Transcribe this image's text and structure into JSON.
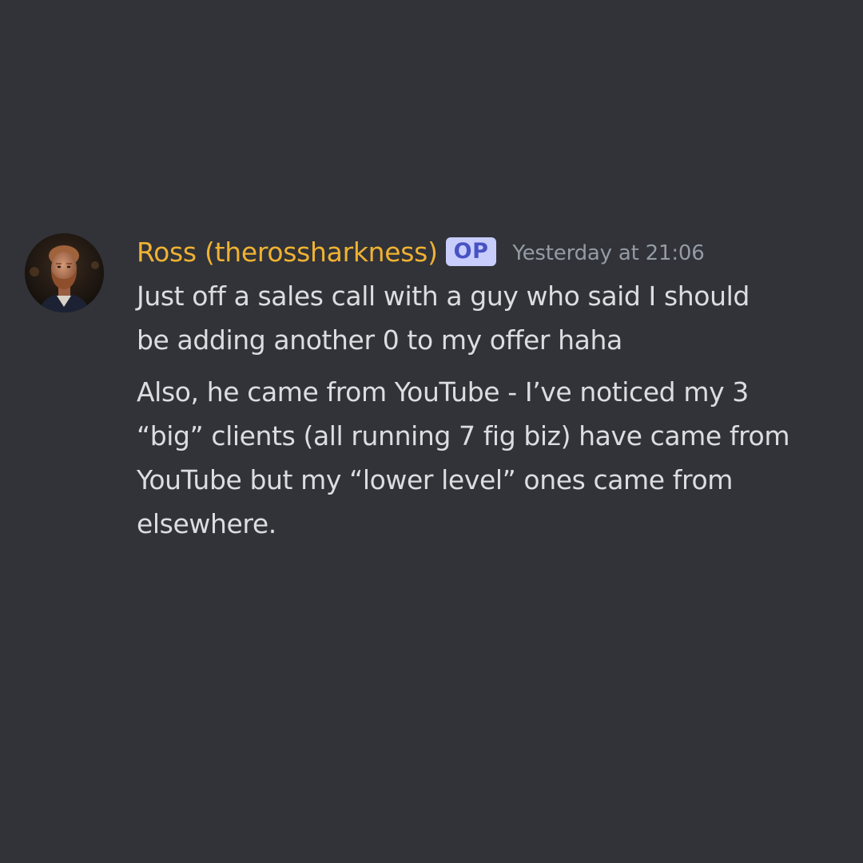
{
  "message": {
    "author": "Ross (therossharkness)",
    "badge": "OP",
    "timestamp": "Yesterday at 21:06",
    "avatar_icon": "user-avatar-photo",
    "paragraphs": [
      "Just off a sales call with a guy who said I should\nbe adding another 0 to my offer haha",
      "Also, he came from YouTube - I’ve noticed my 3\n“big” clients (all running 7 fig biz) have came from\nYouTube but my “lower level” ones came from\nelsewhere."
    ]
  },
  "colors": {
    "background": "#313338",
    "author": "#f0b232",
    "badge_bg": "#c9cdfb",
    "badge_text": "#4752c4",
    "timestamp": "#949ba4",
    "text": "#dbdee1"
  }
}
